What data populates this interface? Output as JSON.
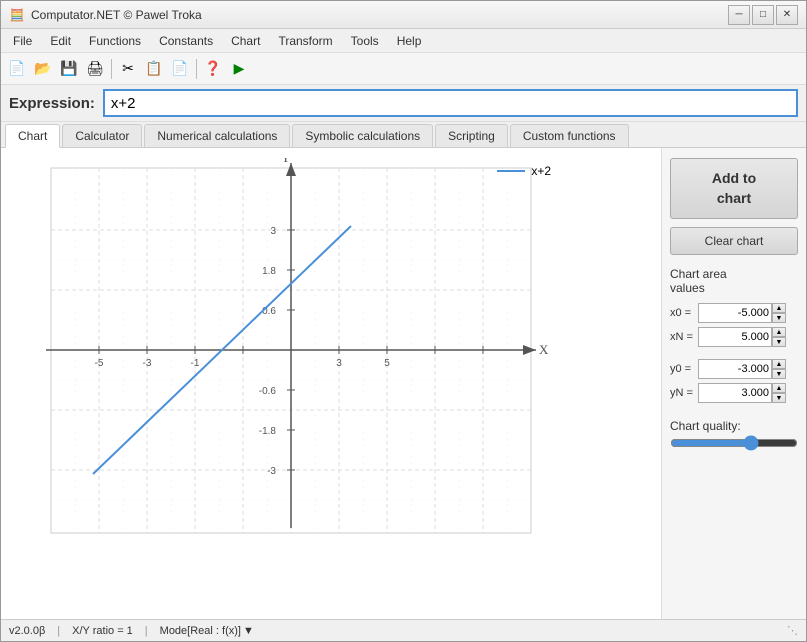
{
  "window": {
    "title": "Computator.NET © Pawel Troka",
    "icon": "🧮"
  },
  "title_controls": {
    "minimize": "─",
    "maximize": "□",
    "close": "✕"
  },
  "menu": {
    "items": [
      "File",
      "Edit",
      "Functions",
      "Constants",
      "Chart",
      "Transform",
      "Tools",
      "Help"
    ]
  },
  "toolbar": {
    "icons": [
      "📄",
      "📂",
      "💾",
      "🖨",
      "✂️",
      "📋",
      "📄",
      "❓",
      "▶"
    ]
  },
  "expression": {
    "label": "Expression:",
    "value": "x+2",
    "placeholder": ""
  },
  "tabs": [
    {
      "label": "Chart",
      "active": true
    },
    {
      "label": "Calculator",
      "active": false
    },
    {
      "label": "Numerical calculations",
      "active": false
    },
    {
      "label": "Symbolic calculations",
      "active": false
    },
    {
      "label": "Scripting",
      "active": false
    },
    {
      "label": "Custom functions",
      "active": false
    }
  ],
  "chart": {
    "legend_label": "x+2",
    "legend_color": "#4a90d9",
    "x_label": "X",
    "y_label": "Y"
  },
  "right_panel": {
    "add_chart_label": "Add to\nchart",
    "clear_chart_label": "Clear chart",
    "chart_area_title": "Chart area\nvalues",
    "x0_label": "x0 =",
    "x0_value": "-5.000",
    "xN_label": "xN =",
    "xN_value": "5.000",
    "y0_label": "y0 =",
    "y0_value": "-3.000",
    "yN_label": "yN =",
    "yN_value": "3.000",
    "chart_quality_label": "Chart quality:"
  },
  "status_bar": {
    "version": "v2.0.0β",
    "ratio": "X/Y ratio = 1",
    "mode": "Mode[Real : f(x)]",
    "mode_arrow": "▼"
  }
}
